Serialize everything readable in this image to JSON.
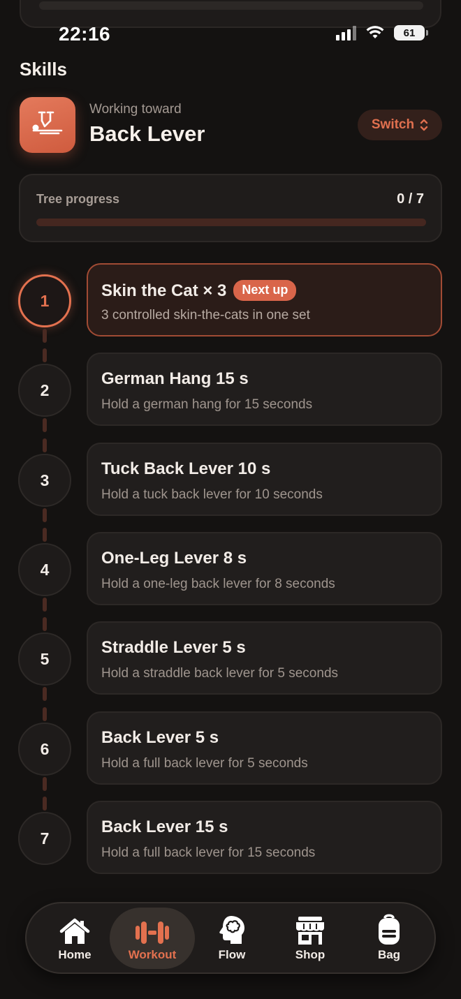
{
  "status_bar": {
    "time": "22:16",
    "battery": "61"
  },
  "header": {
    "title": "Skills",
    "goal_subtitle": "Working toward",
    "goal_title": "Back Lever",
    "switch_label": "Switch",
    "accent_color": "#e0704f"
  },
  "progress": {
    "label": "Tree progress",
    "count_text": "0 / 7",
    "completed": 0,
    "total": 7
  },
  "steps": [
    {
      "number": "1",
      "title": "Skin the Cat × 3",
      "badge": "Next up",
      "description": "3 controlled skin-the-cats in one set",
      "state": "active"
    },
    {
      "number": "2",
      "title": "German Hang 15 s",
      "description": "Hold a german hang for 15 seconds",
      "state": "locked"
    },
    {
      "number": "3",
      "title": "Tuck Back Lever 10 s",
      "description": "Hold a tuck back lever for 10 seconds",
      "state": "locked"
    },
    {
      "number": "4",
      "title": "One-Leg Lever 8 s",
      "description": "Hold a one-leg back lever for 8 seconds",
      "state": "locked"
    },
    {
      "number": "5",
      "title": "Straddle Lever 5 s",
      "description": "Hold a straddle back lever for 5 seconds",
      "state": "locked"
    },
    {
      "number": "6",
      "title": "Back Lever 5 s",
      "description": "Hold a full back lever for 5 seconds",
      "state": "locked"
    },
    {
      "number": "7",
      "title": "Back Lever 15 s",
      "description": "Hold a full back lever for 15 seconds",
      "state": "locked"
    }
  ],
  "tabbar": {
    "items": [
      {
        "label": "Home",
        "icon": "home-icon",
        "active": false
      },
      {
        "label": "Workout",
        "icon": "dumbbell-icon",
        "active": true
      },
      {
        "label": "Flow",
        "icon": "brain-head-icon",
        "active": false
      },
      {
        "label": "Shop",
        "icon": "store-icon",
        "active": false
      },
      {
        "label": "Bag",
        "icon": "backpack-icon",
        "active": false
      }
    ]
  }
}
